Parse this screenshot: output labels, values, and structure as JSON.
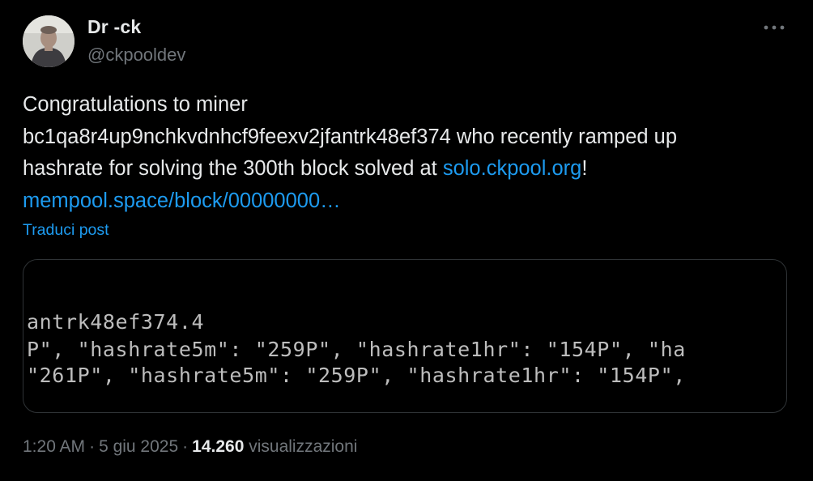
{
  "author": {
    "display_name": "Dr -ck",
    "handle": "@ckpooldev"
  },
  "tweet": {
    "line1": "Congratulations to miner",
    "line2": "bc1qa8r4up9nchkvdnhcf9feexv2jfantrk48ef374 who recently ramped up",
    "line3_prefix": "hashrate for solving the 300th block solved at ",
    "link1": "solo.ckpool.org",
    "line3_suffix": "!",
    "link2": "mempool.space/block/00000000…"
  },
  "translate_label": "Traduci post",
  "media": {
    "code_lines": [
      "antrk48ef374.4",
      "P\", \"hashrate5m\": \"259P\", \"hashrate1hr\": \"154P\", \"ha",
      "\"261P\", \"hashrate5m\": \"259P\", \"hashrate1hr\": \"154P\","
    ]
  },
  "meta": {
    "time": "1:20 AM",
    "date": "5 giu 2025",
    "views_count": "14.260",
    "views_label": "visualizzazioni"
  },
  "icons": {
    "more": "more-horizontal-icon",
    "avatar": "avatar-photo"
  },
  "colors": {
    "background": "#000000",
    "text": "#e7e9ea",
    "secondary": "#71767b",
    "link": "#1d9bf0",
    "border": "#2f3336"
  }
}
